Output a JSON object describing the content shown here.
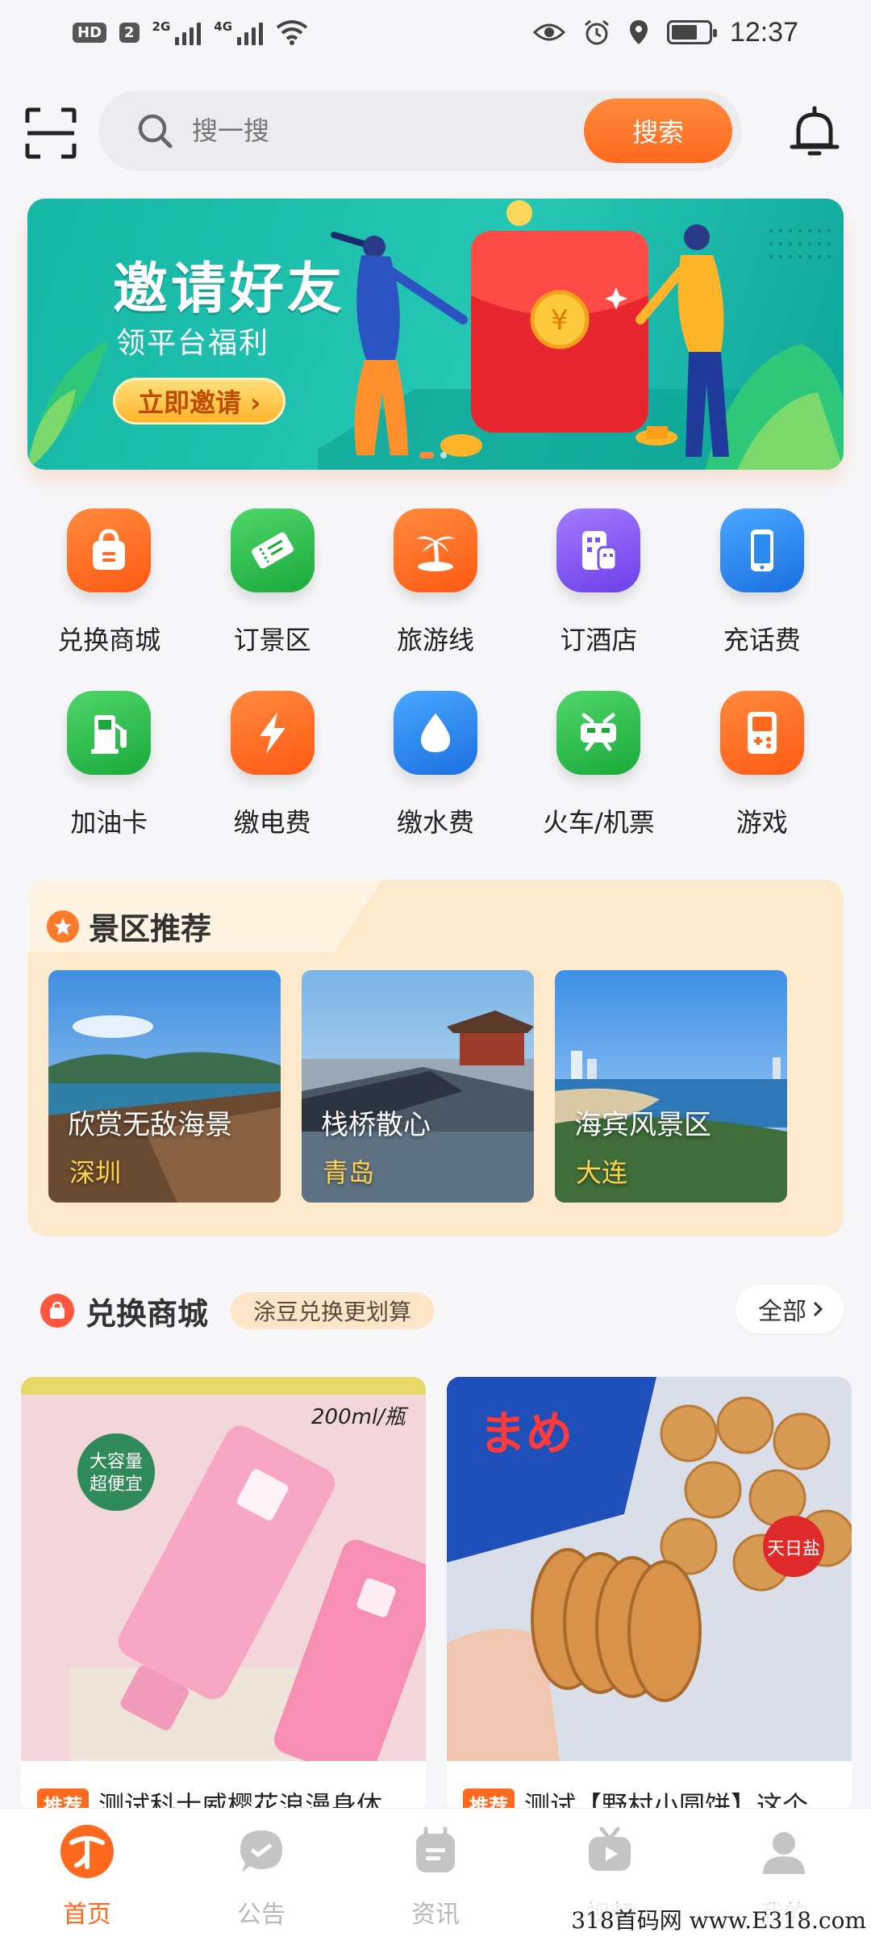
{
  "status_bar": {
    "hd": "HD",
    "sim": "2",
    "net1": "2G",
    "net2": "4G",
    "time": "12:37"
  },
  "search": {
    "placeholder": "搜一搜",
    "button": "搜索"
  },
  "banner": {
    "title": "邀请好友",
    "subtitle": "领平台福利",
    "cta": "立即邀请 ›",
    "slide_count": 2,
    "active_slide": 1
  },
  "categories": [
    {
      "label": "兑换商城",
      "icon": "shopping-bag-icon",
      "color": "#ff6a1e"
    },
    {
      "label": "订景区",
      "icon": "ticket-icon",
      "color": "#2dbf4f"
    },
    {
      "label": "旅游线",
      "icon": "palm-island-icon",
      "color": "#ff6a1e"
    },
    {
      "label": "订酒店",
      "icon": "hotel-icon",
      "color": "#8a5cf0"
    },
    {
      "label": "充话费",
      "icon": "phone-icon",
      "color": "#2a8cf0"
    },
    {
      "label": "加油卡",
      "icon": "fuel-pump-icon",
      "color": "#2dbf4f"
    },
    {
      "label": "缴电费",
      "icon": "lightning-icon",
      "color": "#ff6a1e"
    },
    {
      "label": "缴水费",
      "icon": "water-drop-icon",
      "color": "#2a8cf0"
    },
    {
      "label": "火车/机票",
      "icon": "train-icon",
      "color": "#2dbf4f"
    },
    {
      "label": "游戏",
      "icon": "gamepad-icon",
      "color": "#ff6a1e"
    }
  ],
  "scenic": {
    "title": "景区推荐",
    "items": [
      {
        "name": "欣赏无敌海景",
        "city": "深圳"
      },
      {
        "name": "栈桥散心",
        "city": "青岛"
      },
      {
        "name": "海宾风景区",
        "city": "大连"
      }
    ]
  },
  "mall": {
    "title": "兑换商城",
    "tag": "涂豆兑换更划算",
    "all": "全部",
    "products": [
      {
        "tag": "推荐",
        "title": "测试科士威樱花浪漫身体",
        "img_label": "200ml/瓶"
      },
      {
        "tag": "推荐",
        "title": "测试【野村小圆饼】这个",
        "img_label": "天日盐"
      }
    ]
  },
  "tabs": [
    {
      "label": "首页",
      "icon": "home-logo-icon",
      "active": true
    },
    {
      "label": "公告",
      "icon": "announcement-icon",
      "active": false
    },
    {
      "label": "资讯",
      "icon": "news-icon",
      "active": false
    },
    {
      "label": "视频",
      "icon": "video-icon",
      "active": false
    },
    {
      "label": "我的",
      "icon": "profile-icon",
      "active": false
    }
  ],
  "watermark": "318首码网 www.E318.com",
  "colors": {
    "accent": "#ff6a1e",
    "banner_bg": "#1fbcaa",
    "scenic_bg": "#fde9cc"
  }
}
